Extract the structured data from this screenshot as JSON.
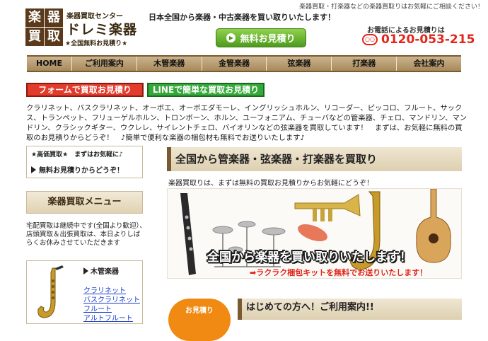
{
  "header": {
    "top_note": "楽器買取・打楽器などの楽器買取りはお気軽にご相談ください！",
    "logo": {
      "box_chars": [
        "楽",
        "器",
        "買",
        "取"
      ],
      "sub": "楽器買取センター",
      "main": "ドレミ楽器",
      "free": "★全国無料お見積り★"
    },
    "tagline": "日本全国から楽器・中古楽器を買い取りいたします！",
    "estimate_button": "無料お見積り",
    "phone_label": "お電話によるお見積りは",
    "freedial_icon": "freedial-icon",
    "phone_number": "0120-053-215"
  },
  "nav": {
    "items": [
      "HOME",
      "ご利用案内",
      "木管楽器",
      "金管楽器",
      "弦楽器",
      "打楽器",
      "会社案内"
    ]
  },
  "buttons": {
    "form": "フォームで買取お見積り",
    "line": "LINEで簡単な買取お見積り"
  },
  "intro": "クラリネット、バスクラリネット、オーボエ、オーボエダモーレ、イングリッシュホルン、リコーダー、ピッコロ、フルート、サックス、トランペット、フリューゲルホルン、トロンボーン、ホルン、ユーフォニアム、チューバなどの管楽器、チェロ、マンドリン、マンドリン、クラシックギター、ウクレレ、サイレントチェロ、バイオリンなどの弦楽器を買取しています！　まずは、お気軽に無料の買取のお見積りからどうぞ！　♪簡単で便利な楽器の梱包材も無料でお送りいたします♪",
  "sidebar": {
    "promo_line1": "★高価買取★　まずはお気軽に♪",
    "promo_line2": "無料お見積りからどうぞ！",
    "menu_title": "楽器買取メニュー",
    "note": "宅配買取は継続中です(全国より歓迎）、店頭買取＆出張買取は、本日よりしばらくお休みさせていただきます",
    "wind_title": "木管楽器",
    "wind_links": [
      "クラリネット",
      "バスクラリネット",
      "フルート",
      "アルトフルート"
    ]
  },
  "main": {
    "heading": "全国から管楽器・弦楽器・打楽器を買取り",
    "subtext": "楽器買取りは、まずは無料の買取お見積りからお気軽にどうぞ！",
    "banner_main": "全国から楽器を買い取りいたします！",
    "banner_sub": "ラクラク梱包キットを無料でお送りいたします！",
    "estimate_circle": "お見積り",
    "first_time": "はじめての方へ！ご利用案内!!"
  },
  "colors": {
    "brown": "#5a3a1a",
    "red": "#e1261c",
    "green": "#35a83a",
    "orange": "#f08a12",
    "link": "#1a3ccc"
  }
}
